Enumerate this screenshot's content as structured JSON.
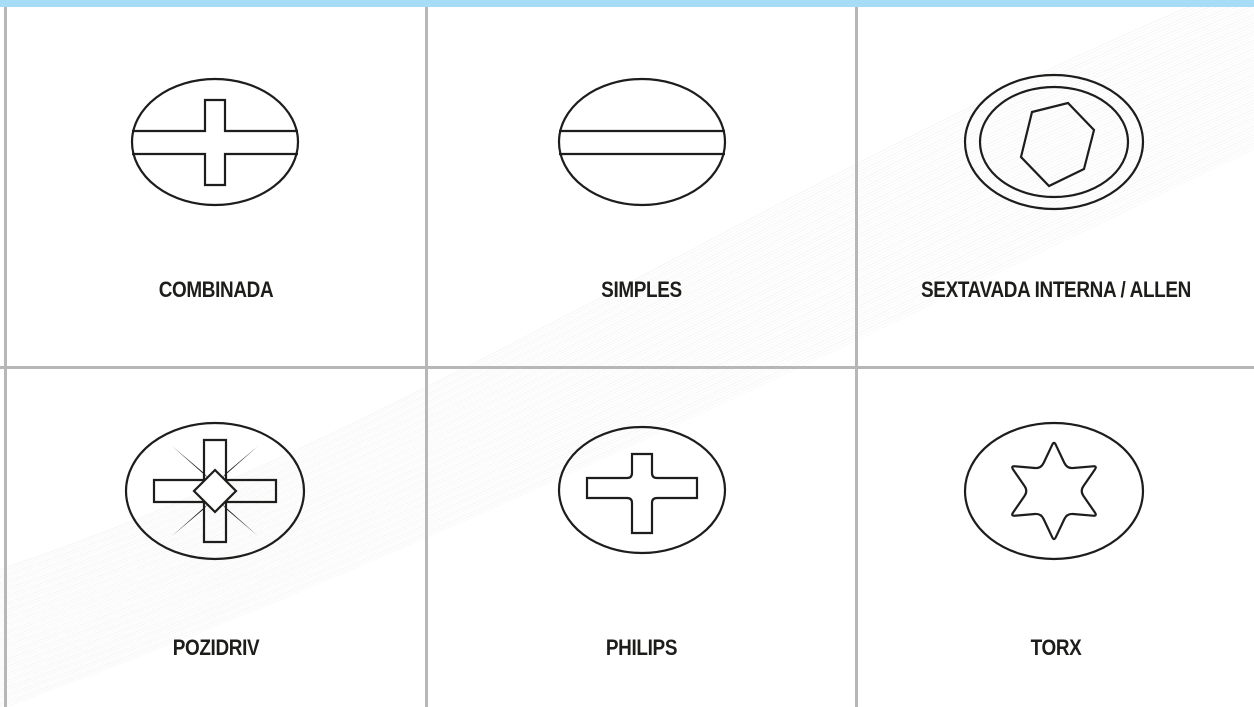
{
  "colors": {
    "accent_bar": "#a6dcf6",
    "grid_lines": "#b7b7b7",
    "stroke": "#1d1d1b",
    "text": "#1d1d1b"
  },
  "tiles": [
    {
      "label": "COMBINADA",
      "icon": "combination-screw-head-icon"
    },
    {
      "label": "SIMPLES",
      "icon": "slotted-screw-head-icon"
    },
    {
      "label": "SEXTAVADA INTERNA / ALLEN",
      "icon": "allen-hex-socket-icon"
    },
    {
      "label": "POZIDRIV",
      "icon": "pozidriv-screw-head-icon"
    },
    {
      "label": "PHILIPS",
      "icon": "phillips-screw-head-icon"
    },
    {
      "label": "TORX",
      "icon": "torx-screw-head-icon"
    }
  ]
}
